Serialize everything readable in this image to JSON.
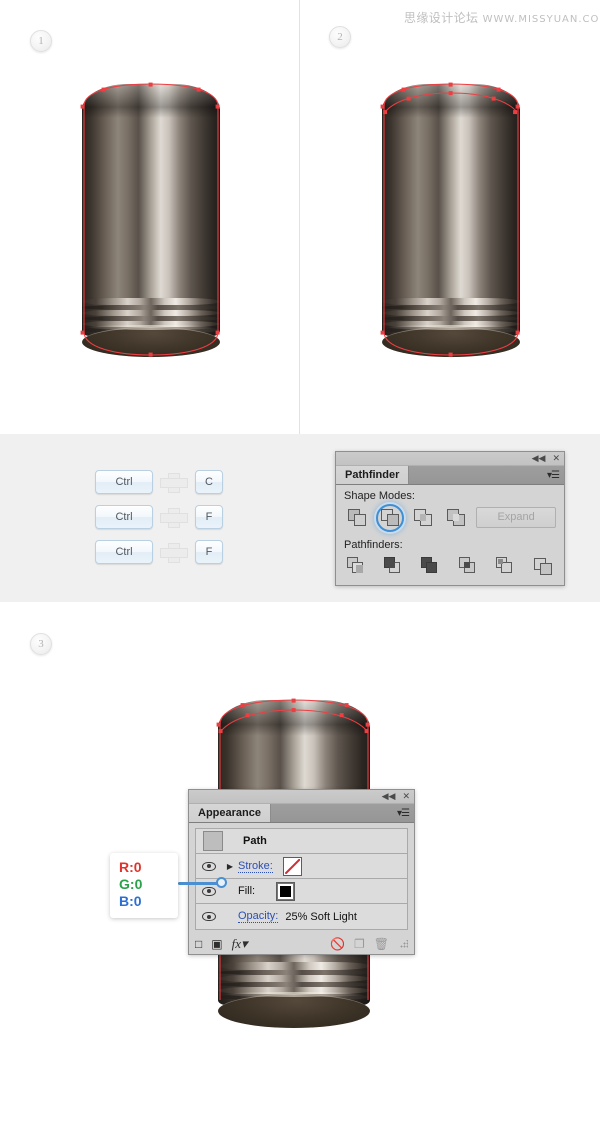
{
  "watermark": {
    "cn": "思缘设计论坛",
    "en": "WWW.MISSYUAN.COM"
  },
  "steps": [
    {
      "number": "1"
    },
    {
      "number": "2"
    },
    {
      "number": "3"
    }
  ],
  "shortcuts": {
    "rows": [
      {
        "modifier": "Ctrl",
        "plus": "+",
        "key": "C"
      },
      {
        "modifier": "Ctrl",
        "plus": "+",
        "key": "F"
      },
      {
        "modifier": "Ctrl",
        "plus": "+",
        "key": "F"
      }
    ]
  },
  "pathfinder_panel": {
    "title": "Pathfinder",
    "collapse_icon": "◀◀",
    "close_icon": "✕",
    "menu_icon": "▾☰",
    "shape_modes_label": "Shape Modes:",
    "pathfinders_label": "Pathfinders:",
    "expand_label": "Expand",
    "shape_modes": [
      {
        "name": "unite",
        "selected": false
      },
      {
        "name": "minus-front",
        "selected": true
      },
      {
        "name": "intersect",
        "selected": false
      },
      {
        "name": "exclude",
        "selected": false
      }
    ],
    "pathfinders": [
      {
        "name": "divide"
      },
      {
        "name": "trim"
      },
      {
        "name": "merge"
      },
      {
        "name": "crop"
      },
      {
        "name": "outline"
      },
      {
        "name": "minus-back"
      }
    ]
  },
  "appearance_panel": {
    "title": "Appearance",
    "collapse_icon": "◀◀",
    "close_icon": "✕",
    "menu_icon": "▾☰",
    "object_label": "Path",
    "rows": [
      {
        "label": "Stroke:",
        "value": "",
        "swatch": "none"
      },
      {
        "label": "Fill:",
        "value": "",
        "swatch": "black"
      },
      {
        "label": "Opacity:",
        "value": "25% Soft Light",
        "swatch": ""
      }
    ],
    "footer_icons": [
      "add-new-stroke",
      "add-new-fill",
      "add-new-effect",
      "clear-appearance",
      "duplicate-item",
      "delete-item"
    ]
  },
  "rgb_callout": {
    "r_label": "R:",
    "r_value": "0",
    "g_label": "G:",
    "g_value": "0",
    "b_label": "B:",
    "b_value": "0"
  },
  "colors": {
    "accent_blue": "#3f8fd4",
    "path_red": "#ef3e42",
    "panel_gray": "#d4d4d4",
    "band_gray": "#f0f0f0",
    "link_blue": "#2b4fb5"
  }
}
